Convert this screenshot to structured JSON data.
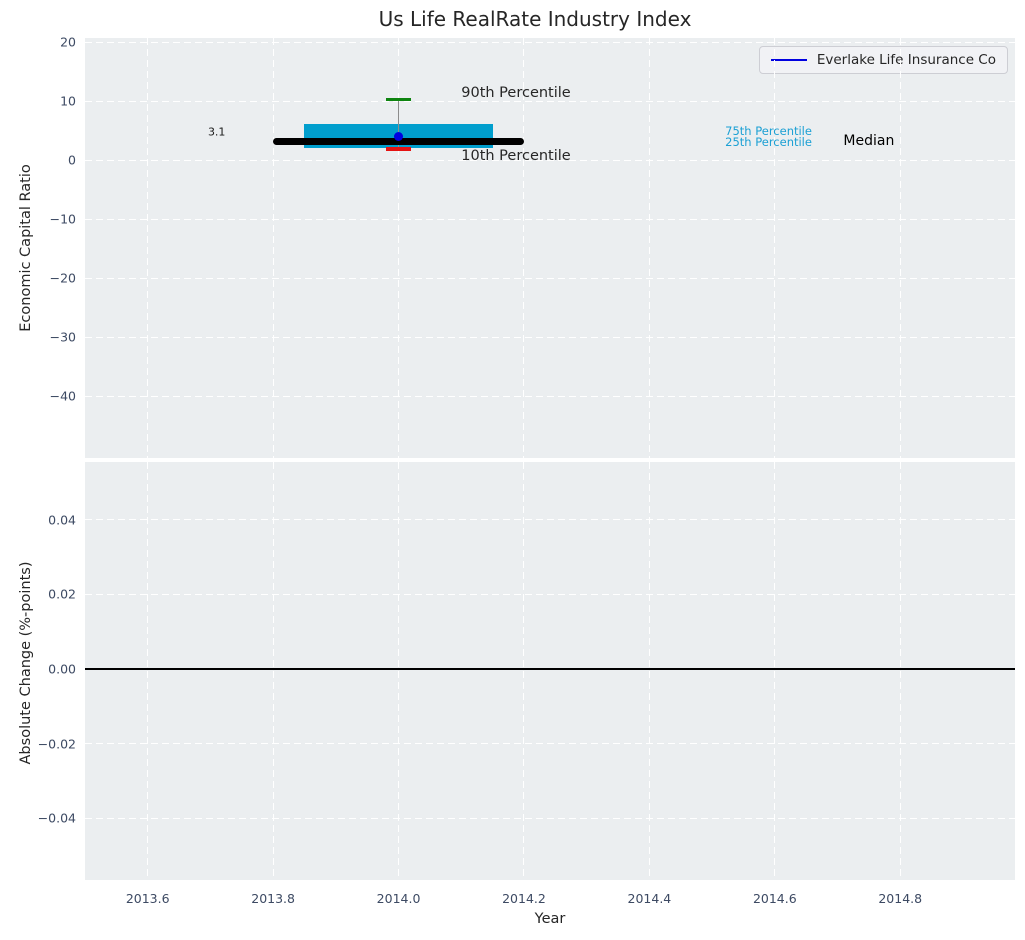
{
  "title": "Us Life RealRate Industry Index",
  "legend": {
    "label": "Everlake Life Insurance Co"
  },
  "colors": {
    "figure_bg": "#ffffff",
    "axes_bg": "#ebeef0",
    "grid": "#ffffff",
    "tick_label": "#3d4a63",
    "text": "#262626",
    "box": "#009ecd",
    "median_line": "#000000",
    "whisker": "#8c8c8c",
    "p90_cap": "#0e8410",
    "p10_cap": "#e51212",
    "company_point": "#0000e0",
    "legend_line": "#0000e0",
    "percentile_text": "#1ba0d4",
    "zero_line": "#000000"
  },
  "chart_data": [
    {
      "type": "box",
      "title": "Us Life RealRate Industry Index",
      "xlabel": "",
      "ylabel": "Economic Capital Ratio",
      "xlim": [
        2013.5,
        2014.983
      ],
      "ylim": [
        -50.5,
        20.75
      ],
      "grid": true,
      "legend_position": "upper right",
      "xticks": [
        {
          "v": 2013.6,
          "label": "2013.6"
        },
        {
          "v": 2013.8,
          "label": "2013.8"
        },
        {
          "v": 2014.0,
          "label": "2014.0"
        },
        {
          "v": 2014.2,
          "label": "2014.2"
        },
        {
          "v": 2014.4,
          "label": "2014.4"
        },
        {
          "v": 2014.6,
          "label": "2014.6"
        },
        {
          "v": 2014.8,
          "label": "2014.8"
        }
      ],
      "yticks": [
        {
          "v": 20,
          "label": "20"
        },
        {
          "v": 10,
          "label": "10"
        },
        {
          "v": 0,
          "label": "0"
        },
        {
          "v": -10,
          "label": "−10"
        },
        {
          "v": -20,
          "label": "−20"
        },
        {
          "v": -30,
          "label": "−30"
        },
        {
          "v": -40,
          "label": "−40"
        }
      ],
      "percentiles": {
        "x": 2014.0,
        "p90": 10.3,
        "p75": 6.1,
        "median": 3.2,
        "p25": 2.05,
        "p10": 1.95,
        "box_x_range": [
          2013.85,
          2014.15
        ],
        "median_x_range": [
          2013.8,
          2014.2
        ],
        "cap_x_range": [
          2013.98,
          2014.02
        ]
      },
      "series": [
        {
          "name": "Everlake Life Insurance Co",
          "x": 2014.0,
          "point_y": 4.1,
          "value_label": "3.1"
        }
      ],
      "annotations": [
        {
          "text": "3.1",
          "x": 2013.71,
          "y": 4.75,
          "anchor": "center",
          "role": "company-value-label"
        },
        {
          "text": "90th Percentile",
          "x": 2014.1,
          "y": 11.5,
          "anchor": "start",
          "role": "p90-label"
        },
        {
          "text": "10th Percentile",
          "x": 2014.1,
          "y": 0.65,
          "anchor": "start",
          "role": "p10-label"
        },
        {
          "text": "75th Percentile",
          "x": 2014.59,
          "y": 5.0,
          "anchor": "center",
          "role": "p75-label"
        },
        {
          "text": "25th Percentile",
          "x": 2014.59,
          "y": 3.1,
          "anchor": "center",
          "role": "p25-label"
        },
        {
          "text": "Median",
          "x": 2014.75,
          "y": 3.2,
          "anchor": "center",
          "role": "median-label"
        }
      ]
    },
    {
      "type": "line",
      "title": "",
      "xlabel": "Year",
      "ylabel": "Absolute Change (%-points)",
      "xlim": [
        2013.5,
        2014.983
      ],
      "ylim": [
        -0.0565,
        0.0555
      ],
      "grid": true,
      "zero_line_y": 0.0,
      "xticks": [
        {
          "v": 2013.6,
          "label": "2013.6"
        },
        {
          "v": 2013.8,
          "label": "2013.8"
        },
        {
          "v": 2014.0,
          "label": "2014.0"
        },
        {
          "v": 2014.2,
          "label": "2014.2"
        },
        {
          "v": 2014.4,
          "label": "2014.4"
        },
        {
          "v": 2014.6,
          "label": "2014.6"
        },
        {
          "v": 2014.8,
          "label": "2014.8"
        }
      ],
      "yticks": [
        {
          "v": 0.04,
          "label": "0.04"
        },
        {
          "v": 0.02,
          "label": "0.02"
        },
        {
          "v": 0.0,
          "label": "0.00"
        },
        {
          "v": -0.02,
          "label": "−0.02"
        },
        {
          "v": -0.04,
          "label": "−0.04"
        }
      ]
    }
  ]
}
